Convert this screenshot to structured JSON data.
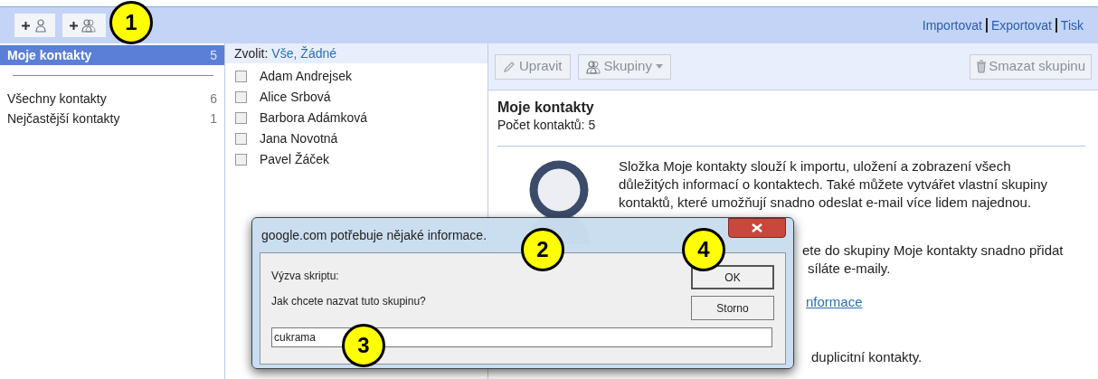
{
  "top_bar": {
    "links": [
      "Importovat",
      "Exportovat",
      "Tisk"
    ]
  },
  "sidebar": {
    "items": [
      {
        "label": "Moje kontakty",
        "count": "5",
        "selected": true
      },
      {
        "label": "Všechny kontakty",
        "count": "6",
        "selected": false
      },
      {
        "label": "Nejčastější kontakty",
        "count": "1",
        "selected": false
      }
    ]
  },
  "contacts": {
    "select_label": "Zvolit:",
    "select_links": [
      "Vše,",
      "Žádné"
    ],
    "items": [
      {
        "name": "Adam Andrejsek",
        "checked": false
      },
      {
        "name": "Alice Srbová",
        "checked": false
      },
      {
        "name": "Barbora Adámková",
        "checked": false
      },
      {
        "name": "Jana Novotná",
        "checked": false
      },
      {
        "name": "Pavel Žáček",
        "checked": false
      }
    ]
  },
  "detail": {
    "toolbar": [
      {
        "kind": "edit",
        "label": "Upravit",
        "disabled": true
      },
      {
        "kind": "groups",
        "label": "Skupiny",
        "disabled": true
      },
      {
        "kind": "delete",
        "label": "Smazat skupinu",
        "disabled": true
      }
    ],
    "title": "Moje kontakty",
    "count_text": "Počet kontaktů: 5",
    "description": "Složka Moje kontakty slouží k importu, uložení a zobrazení všech důležitých informací o kontaktech. Také můžete vytvářet vlastní skupiny kontaktů, které umožňují snadno odeslat e-mail více lidem najednou.",
    "partial_lines": [
      "ete do skupiny Moje kontakty snadno přidat",
      "síláte e-maily."
    ],
    "partial_link": "nformace",
    "partial_tail": "duplicitní kontakty."
  },
  "dialog": {
    "title": "google.com potřebuje nějaké informace.",
    "prompt_label": "Výzva skriptu:",
    "question": "Jak chcete nazvat tuto skupinu?",
    "value": "cukrama",
    "buttons": [
      {
        "label": "OK",
        "default": true
      },
      {
        "label": "Storno",
        "default": false
      }
    ]
  },
  "callouts": [
    "1",
    "2",
    "3",
    "4"
  ]
}
